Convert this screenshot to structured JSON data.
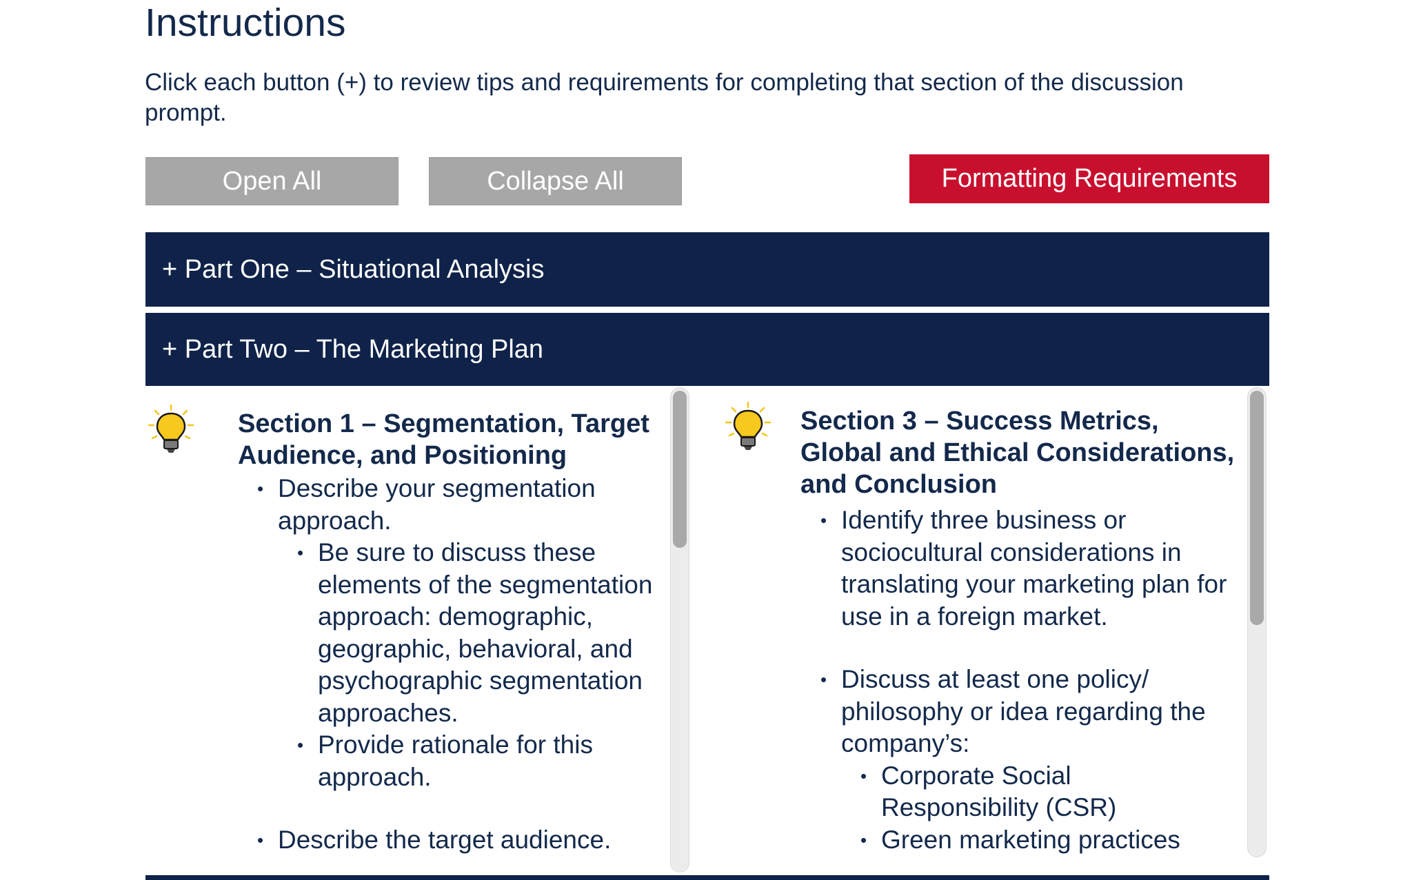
{
  "page": {
    "title": "Instructions",
    "intro": "Click each button (+) to review tips and requirements for completing that section of the discussion prompt."
  },
  "toolbar": {
    "open_all": "Open All",
    "collapse_all": "Collapse All",
    "formatting": "Formatting Requirements"
  },
  "accordion": {
    "part_one": "+ Part One – Situational Analysis",
    "part_two": "+ Part Two –  The Marketing Plan"
  },
  "left_panel": {
    "icon": "lightbulb-icon",
    "title": "Section 1  – Segmentation, Target Audience, and Positioning",
    "items": [
      "Describe your segmentation approach.",
      "Be sure to discuss these elements of the segmentation approach: demographic, geographic, behavioral, and psychographic segmentation approaches.",
      "Provide rationale for this approach.",
      "Describe the target audience."
    ]
  },
  "right_panel": {
    "icon": "lightbulb-icon",
    "title": "Section 3 – Success Metrics, Global and Ethical Considerations, and Conclusion",
    "items": [
      "Identify three business or sociocultural considerations in translating your marketing plan for use in a foreign market.",
      "Discuss at least one policy/ philosophy or idea regarding the company’s:",
      "Corporate Social Responsibility (CSR)",
      "Green marketing practices"
    ]
  },
  "colors": {
    "navy": "#0f2249",
    "text": "#13294b",
    "red": "#c8102e",
    "gray_button": "#a7a7a7",
    "bulb": "#f5c518"
  }
}
